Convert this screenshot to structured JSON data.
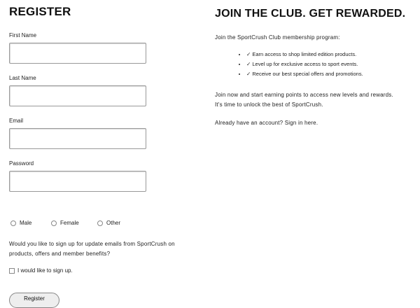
{
  "register": {
    "title": "REGISTER",
    "fields": [
      {
        "label": "First Name",
        "value": "",
        "placeholder": ""
      },
      {
        "label": "Last Name",
        "value": "",
        "placeholder": ""
      },
      {
        "label": "Email",
        "value": "",
        "placeholder": ""
      },
      {
        "label": "Password",
        "value": "",
        "placeholder": ""
      }
    ],
    "gender_options": [
      "Male",
      "Female",
      "Other"
    ],
    "newsletter_text": "Would you like to sign up for update emails from SportCrush on products, offers and member benefits?",
    "signup_checkbox_label": "I would like to sign up.",
    "register_button": "Register"
  },
  "club": {
    "title": "JOIN THE CLUB. GET REWARDED.",
    "intro": "Join the SportCrush Club membership program:",
    "benefits": [
      "✓ Earn access to shop limited edition products.",
      "✓ Level up for exclusive access to sport events.",
      "✓ Receive our best special offers and promotions."
    ],
    "join_line_1": "Join now and start earning points to access new levels and rewards.",
    "join_line_2": "It's time to unlock the best of SportCrush.",
    "signin_text": "Already have an account? Sign in here."
  }
}
